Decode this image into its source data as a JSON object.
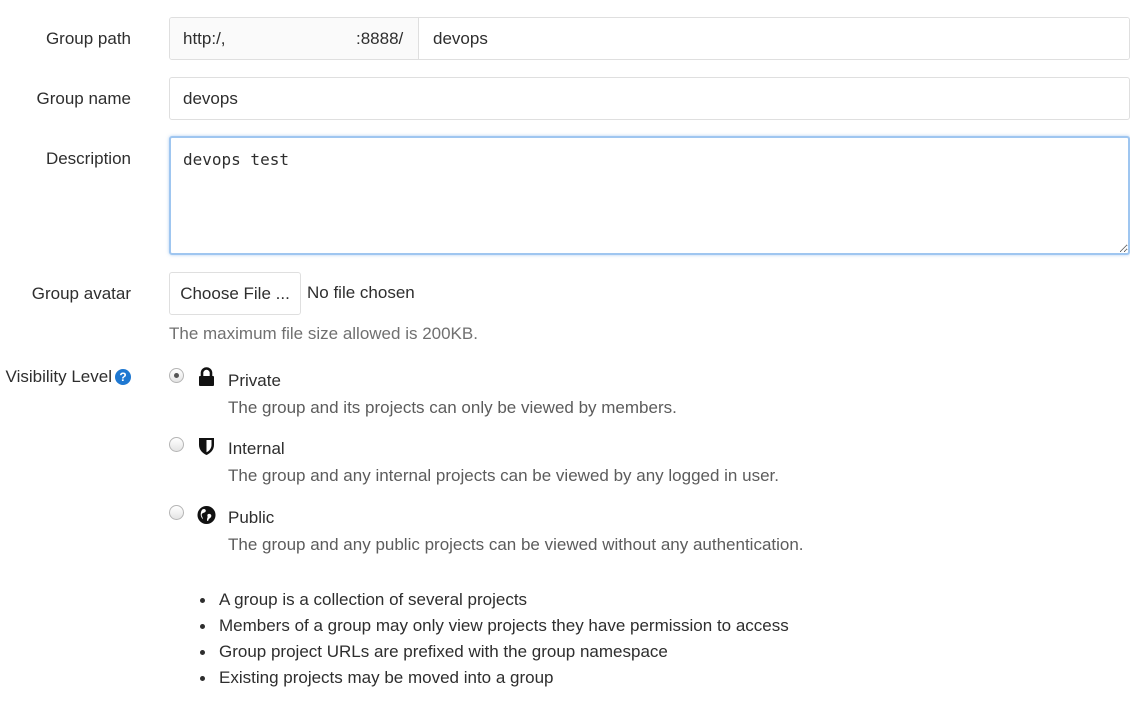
{
  "form": {
    "group_path": {
      "label": "Group path",
      "prefix_start": "http:/,",
      "prefix_end": ":8888/",
      "value": "devops"
    },
    "group_name": {
      "label": "Group name",
      "value": "devops"
    },
    "description": {
      "label": "Description",
      "value": "devops test"
    },
    "group_avatar": {
      "label": "Group avatar",
      "button_label": "Choose File ...",
      "status": "No file chosen",
      "help": "The maximum file size allowed is 200KB."
    },
    "visibility": {
      "label": "Visibility Level",
      "help_icon": "question-circle-icon",
      "selected": "Private",
      "options": [
        {
          "title": "Private",
          "description": "The group and its projects can only be viewed by members.",
          "icon": "lock-icon"
        },
        {
          "title": "Internal",
          "description": "The group and any internal projects can be viewed by any logged in user.",
          "icon": "shield-icon"
        },
        {
          "title": "Public",
          "description": "The group and any public projects can be viewed without any authentication.",
          "icon": "globe-icon"
        }
      ]
    },
    "info": [
      "A group is a collection of several projects",
      "Members of a group may only view projects they have permission to access",
      "Group project URLs are prefixed with the group namespace",
      "Existing projects may be moved into a group"
    ]
  }
}
